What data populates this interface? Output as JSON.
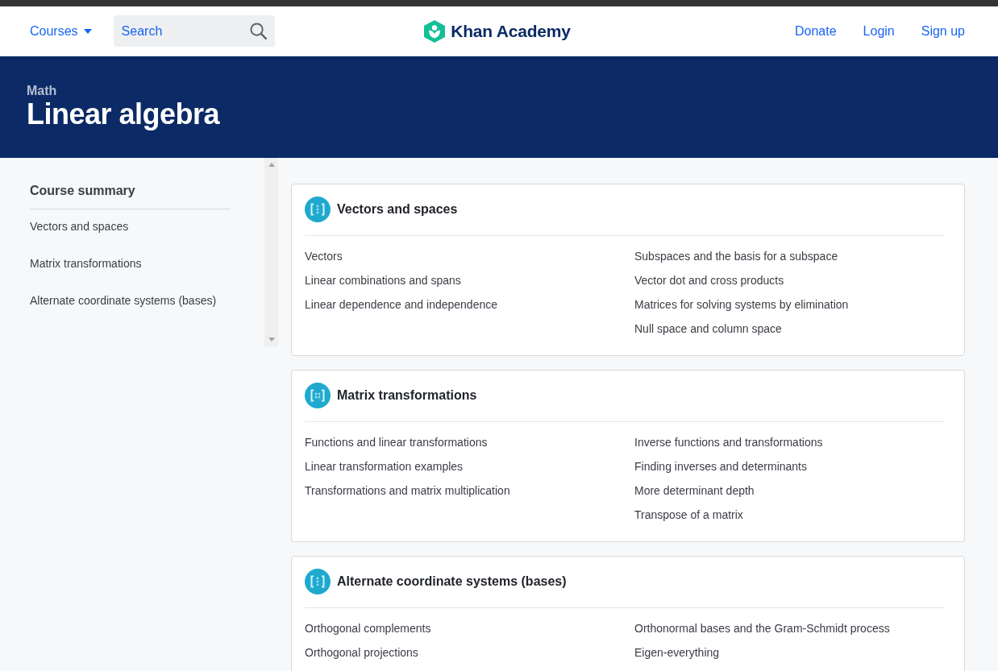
{
  "header": {
    "nav_menu": "Courses",
    "search": {
      "placeholder": "Search"
    },
    "logo": "Khan Academy",
    "links": [
      "Donate",
      "Login",
      "Sign up"
    ]
  },
  "banner": {
    "subject": "Math",
    "title": "Linear algebra"
  },
  "sidebar": {
    "title": "Course summary",
    "items": [
      "Vectors and spaces",
      "Matrix transformations",
      "Alternate coordinate systems (bases)"
    ]
  },
  "units": [
    {
      "kind": "vector",
      "title": "Vectors and spaces",
      "lesson_columns": [
        [
          "Vectors",
          "Linear combinations and spans",
          "Linear dependence and independence"
        ],
        [
          "Subspaces and the basis for a subspace",
          "Vector dot and cross products",
          "Matrices for solving systems by elimination",
          "Null space and column space"
        ]
      ]
    },
    {
      "kind": "matrix",
      "title": "Matrix transformations",
      "lesson_columns": [
        [
          "Functions and linear transformations",
          "Linear transformation examples",
          "Transformations and matrix multiplication"
        ],
        [
          "Inverse functions and transformations",
          "Finding inverses and determinants",
          "More determinant depth",
          "Transpose of a matrix"
        ]
      ]
    },
    {
      "kind": "vector",
      "title": "Alternate coordinate systems (bases)",
      "lesson_columns": [
        [
          "Orthogonal complements",
          "Orthogonal projections"
        ],
        [
          "Orthonormal bases and the Gram-Schmidt process",
          "Eigen-everything"
        ]
      ]
    }
  ]
}
